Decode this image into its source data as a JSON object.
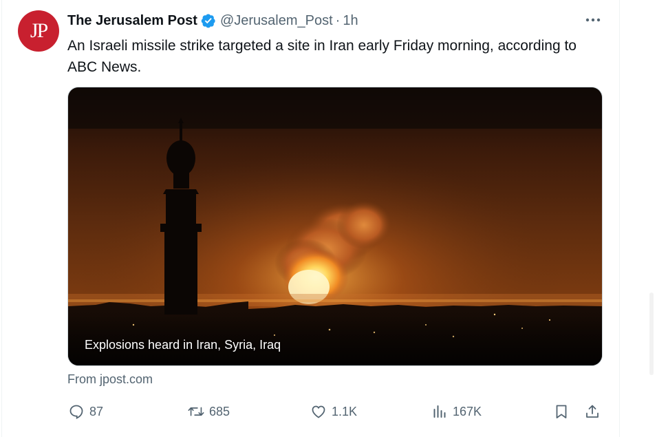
{
  "tweet": {
    "avatar_text": "JP",
    "display_name": "The Jerusalem Post",
    "handle": "@Jerusalem_Post",
    "separator": "·",
    "time": "1h",
    "text": "An Israeli missile strike targeted a site in Iran early Friday morning, according to ABC News.",
    "media_caption": "Explosions heard in Iran, Syria, Iraq",
    "source": "From jpost.com"
  },
  "actions": {
    "replies": "87",
    "retweets": "685",
    "likes": "1.1K",
    "views": "167K"
  },
  "icons": {
    "verified": "verified-badge-icon",
    "more": "more-options-icon",
    "reply": "reply-icon",
    "retweet": "retweet-icon",
    "like": "heart-icon",
    "views": "views-chart-icon",
    "bookmark": "bookmark-icon",
    "share": "share-icon"
  },
  "colors": {
    "avatar_bg": "#c8202f",
    "verified": "#1d9bf0",
    "secondary_text": "#536471",
    "primary_text": "#0f1419"
  }
}
